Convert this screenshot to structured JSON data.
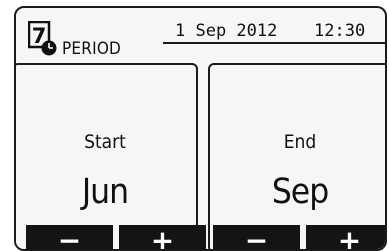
{
  "header": {
    "mode_number": "7",
    "title": "PERIOD",
    "date": "1 Sep 2012",
    "time": "12:30"
  },
  "start": {
    "label": "Start",
    "value": "Jun"
  },
  "end": {
    "label": "End",
    "value": "Sep"
  },
  "buttons": {
    "start_minus": "−",
    "start_plus": "+",
    "end_minus": "−",
    "end_plus": "+"
  },
  "icons": {
    "mode": "mode-clock-icon"
  },
  "colors": {
    "screen": "#f6f6f6",
    "ink": "#1b1b1b",
    "button": "#141414"
  }
}
